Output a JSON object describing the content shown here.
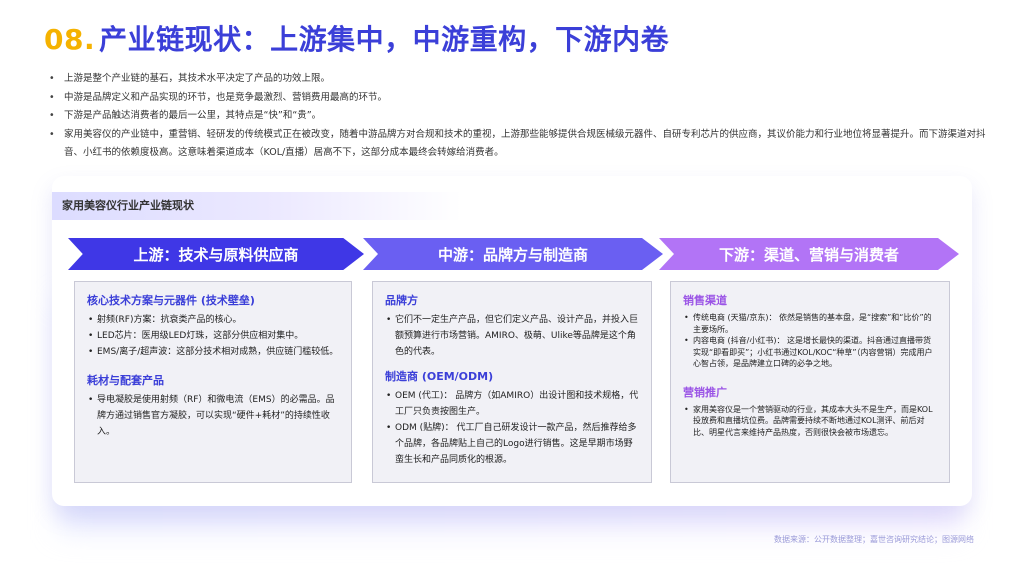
{
  "title": {
    "number": "08.",
    "text": "产业链现状：上游集中，中游重构，下游内卷"
  },
  "bullets": [
    "上游是整个产业链的基石，其技术水平决定了产品的功效上限。",
    "中游是品牌定义和产品实现的环节，也是竞争最激烈、营销费用最高的环节。",
    "下游是产品触达消费者的最后一公里，其特点是“快”和“贵”。",
    "家用美容仪的产业链中，重营销、轻研发的传统模式正在被改变，随着中游品牌方对合规和技术的重视，上游那些能够提供合规医械级元器件、自研专利芯片的供应商，其议价能力和行业地位将显著提升。而下游渠道对抖音、小红书的依赖度极高。这意味着渠道成本（KOL/直播）居高不下，这部分成本最终会转嫁给消费者。"
  ],
  "panel_title": "家用美容仪行业产业链现状",
  "stages": [
    {
      "arrow": "上游：技术与原料供应商",
      "sections": [
        {
          "title": "核心技术方案与元器件 (技术壁垒)",
          "items": [
            "射频(RF)方案：抗衰类产品的核心。",
            "LED芯片：医用级LED灯珠，这部分供应相对集中。",
            "EMS/离子/超声波：这部分技术相对成熟，供应链门槛较低。"
          ]
        },
        {
          "title": "耗材与配套产品",
          "items": [
            "导电凝胶是使用射频（RF）和微电流（EMS）的必需品。品牌方通过销售官方凝胶，可以实现“硬件+耗材”的持续性收入。"
          ]
        }
      ]
    },
    {
      "arrow": "中游：品牌方与制造商",
      "sections": [
        {
          "title": "品牌方",
          "items": [
            "它们不一定生产产品，但它们定义产品、设计产品，并投入巨额预算进行市场营销。AMIRO、极萌、Ulike等品牌是这个角色的代表。"
          ]
        },
        {
          "title": "制造商 (OEM/ODM)",
          "items": [
            "OEM (代工)： 品牌方（如AMIRO）出设计图和技术规格，代工厂只负责按图生产。",
            "ODM (贴牌)： 代工厂自己研发设计一款产品，然后推荐给多个品牌，各品牌贴上自己的Logo进行销售。这是早期市场野蛮生长和产品同质化的根源。"
          ]
        }
      ]
    },
    {
      "arrow": "下游：渠道、营销与消费者",
      "sections": [
        {
          "title": "销售渠道",
          "items": [
            "传统电商 (天猫/京东)： 依然是销售的基本盘，是“搜索”和“比价”的主要场所。",
            "内容电商 (抖音/小红书)： 这是增长最快的渠道。抖音通过直播带货实现“即看即买”；小红书通过KOL/KOC“种草”（内容营销）完成用户心智占领，是品牌建立口碑的必争之地。"
          ]
        },
        {
          "title": "营销推广",
          "items": [
            "家用美容仪是一个营销驱动的行业，其成本大头不是生产，而是KOL投放费和直播坑位费。品牌需要持续不断地通过KOL测评、前后对比、明星代言来维持产品热度，否则很快会被市场遗忘。"
          ]
        }
      ]
    }
  ],
  "source": "数据来源：公开数据整理；嘉世咨询研究结论；图源网络",
  "colors": {
    "title_blue": "#3b3fd8",
    "title_number": "#f5b200",
    "upstream": "#3f37e6",
    "midstream": "#6a5ff2",
    "downstream": "#b274f6",
    "downstream_heading": "#9b55e6"
  }
}
